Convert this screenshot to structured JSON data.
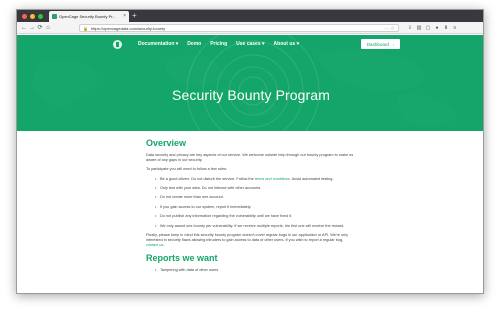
{
  "browser": {
    "tab_title": "OpenCage Security Bounty Pr...",
    "tab_close": "×",
    "new_tab": "+",
    "url": "https://opencagedata.com/security-bounty",
    "nav_back": "←",
    "nav_forward": "→",
    "nav_reload": "⟳",
    "nav_home": "⌂",
    "lock": "🔒",
    "url_actions": "⋯ ☆",
    "toolbar_icons": [
      "⇩",
      "▥",
      "▢",
      "●",
      "⬇",
      "≡"
    ]
  },
  "nav": {
    "items": [
      {
        "label": "Documentation ▾"
      },
      {
        "label": "Demo"
      },
      {
        "label": "Pricing"
      },
      {
        "label": "Use cases ▾"
      },
      {
        "label": "About us ▾"
      }
    ],
    "dashboard_label": "Dashboard",
    "dashboard_chevron": "›"
  },
  "hero": {
    "title": "Security Bounty Program"
  },
  "overview": {
    "heading": "Overview",
    "intro": "Data security and privacy are key aspects of our service. We welcome outside help through our bounty program to make us aware of any gaps in our security.",
    "rules_intro": "To participate you will need to follow a few rules:",
    "rules": [
      {
        "before": "Be a good citizen. Do not disturb the service. Follow the ",
        "link": "terms and conditions",
        "after": ". Avoid automated testing."
      },
      {
        "before": "Only test with your data. Do not interact with other accounts.",
        "link": "",
        "after": ""
      },
      {
        "before": "Do not create more than one account.",
        "link": "",
        "after": ""
      },
      {
        "before": "If you gain access to our system, report it immediately.",
        "link": "",
        "after": ""
      },
      {
        "before": "Do not publish any information regarding the vulnerability until we have fixed it.",
        "link": "",
        "after": ""
      },
      {
        "before": "We only award one bounty per vulnerability. If we receive multiple reports, the first one will receive the reward.",
        "link": "",
        "after": ""
      }
    ],
    "closing_before": "Finally, please keep in mind this security bounty program doesn't cover regular bugs in our application or API. We're only interested in security flaws allowing intruders to gain access to data of other users. If you wish to report a regular bug, ",
    "closing_link": "contact us",
    "closing_after": "."
  },
  "reports": {
    "heading": "Reports we want",
    "items": [
      "Tampering with data of other users"
    ]
  },
  "colors": {
    "brand": "#14a56a",
    "chrome_dark": "#38383d"
  }
}
